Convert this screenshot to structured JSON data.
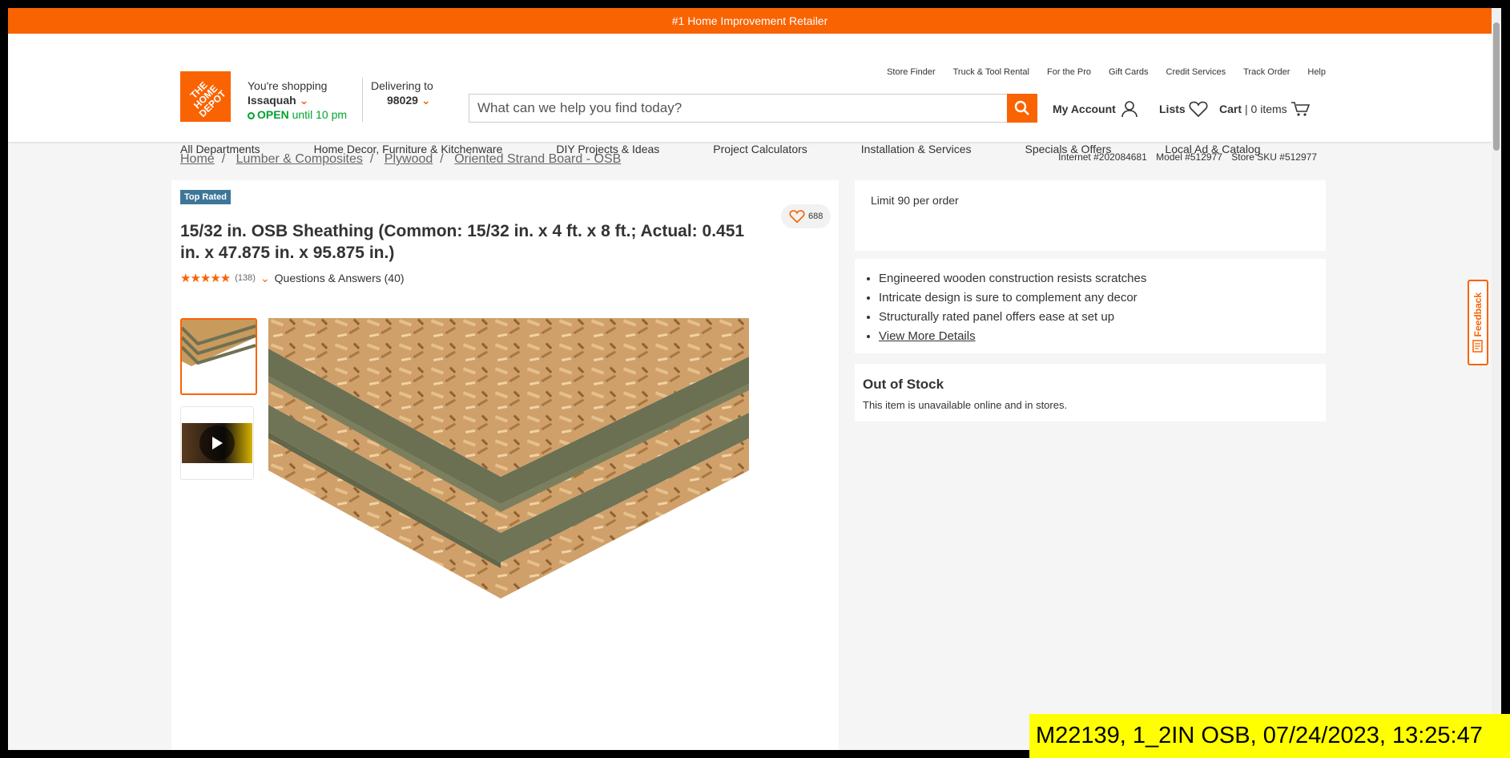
{
  "promo": {
    "text": "#1 Home Improvement Retailer"
  },
  "logo": {
    "line1": "THE",
    "line2": "HOME",
    "line3": "DEPOT"
  },
  "store": {
    "label": "You're shopping",
    "name": "Issaquah",
    "status": "OPEN",
    "hours": "until 10 pm"
  },
  "delivery": {
    "label": "Delivering to",
    "zip": "98029"
  },
  "search": {
    "placeholder": "What can we help you find today?"
  },
  "utility_links": [
    "Store Finder",
    "Truck & Tool Rental",
    "For the Pro",
    "Gift Cards",
    "Credit Services",
    "Track Order",
    "Help"
  ],
  "account": {
    "label": "My Account"
  },
  "lists": {
    "label": "Lists"
  },
  "cart": {
    "label": "Cart",
    "count": "| 0 items"
  },
  "nav": [
    "All Departments",
    "Home Decor, Furniture & Kitchenware",
    "DIY Projects & Ideas",
    "Project Calculators",
    "Installation & Services",
    "Specials & Offers",
    "Local Ad & Catalog"
  ],
  "breadcrumb": [
    "Home",
    "Lumber & Composites",
    "Plywood",
    "Oriented Strand Board - OSB"
  ],
  "ids": {
    "internet": "Internet #202084681",
    "model": "Model #512977",
    "sku": "Store SKU #512977"
  },
  "product": {
    "badge": "Top Rated",
    "favorites": "688",
    "title": "15/32 in. OSB Sheathing (Common: 15/32 in. x 4 ft. x 8 ft.; Actual: 0.451 in. x 47.875 in. x 95.875 in.)",
    "rating": 4.5,
    "stars": "★★★★★",
    "review_count": "(138)",
    "qa": "Questions & Answers (40)"
  },
  "limit": "Limit 90 per order",
  "bullets": [
    "Engineered wooden construction resists scratches",
    "Intricate design is sure to complement any decor",
    "Structurally rated panel offers ease at set up"
  ],
  "view_more": "View More Details",
  "stock": {
    "title": "Out of Stock",
    "text": "This item is unavailable online and in stores."
  },
  "feedback": "Feedback",
  "stamp": "M22139, 1_2IN OSB, 07/24/2023, 13:25:47",
  "colors": {
    "brand": "#f96302",
    "open": "#00a330",
    "badge": "#3e7697"
  }
}
